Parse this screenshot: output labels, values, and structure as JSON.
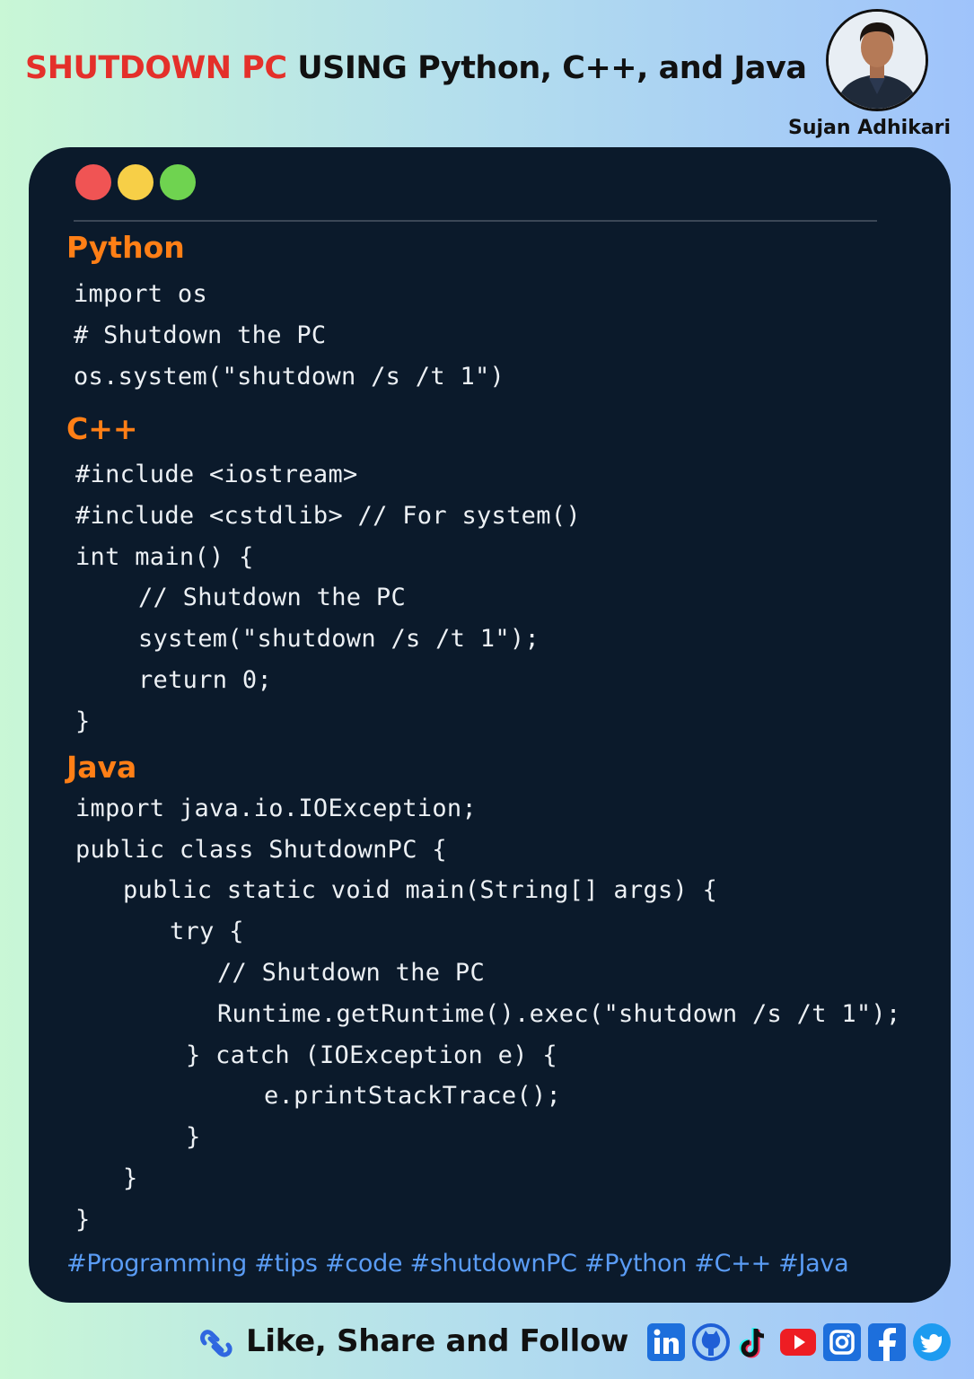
{
  "header": {
    "title_highlight": "SHUTDOWN PC",
    "title_rest": " USING Python, C++, and Java",
    "author": "Sujan Adhikari"
  },
  "sections": {
    "python": {
      "label": "Python",
      "lines": [
        "import os",
        "# Shutdown the PC",
        "os.system(\"shutdown /s /t 1\")"
      ]
    },
    "cpp": {
      "label": "C++",
      "lines": [
        "#include <iostream>",
        "#include <cstdlib> // For system()",
        "int main() {",
        "// Shutdown the PC",
        "system(\"shutdown /s /t 1\");",
        "return 0;",
        "}"
      ]
    },
    "java": {
      "label": "Java",
      "lines": [
        "import java.io.IOException;",
        "public class ShutdownPC {",
        "public static void main(String[] args) {",
        "try {",
        "// Shutdown the PC",
        "Runtime.getRuntime().exec(\"shutdown /s /t 1\");",
        "} catch (IOException e) {",
        "e.printStackTrace();",
        "}",
        "}",
        "}"
      ]
    }
  },
  "hashtags": "#Programming #tips #code #shutdownPC #Python #C++ #Java",
  "footer": {
    "cta": "Like, Share and Follow",
    "icons": [
      "share-icon",
      "linkedin-icon",
      "github-icon",
      "tiktok-icon",
      "youtube-icon",
      "instagram-icon",
      "facebook-icon",
      "twitter-icon"
    ]
  },
  "colors": {
    "title_highlight": "#e4302a",
    "card_bg": "#0b1a2b",
    "lang_label": "#ff7f16",
    "hashtags": "#5a9cf5",
    "dot_red": "#f05454",
    "dot_yellow": "#f7cf47",
    "dot_green": "#6fd350"
  }
}
